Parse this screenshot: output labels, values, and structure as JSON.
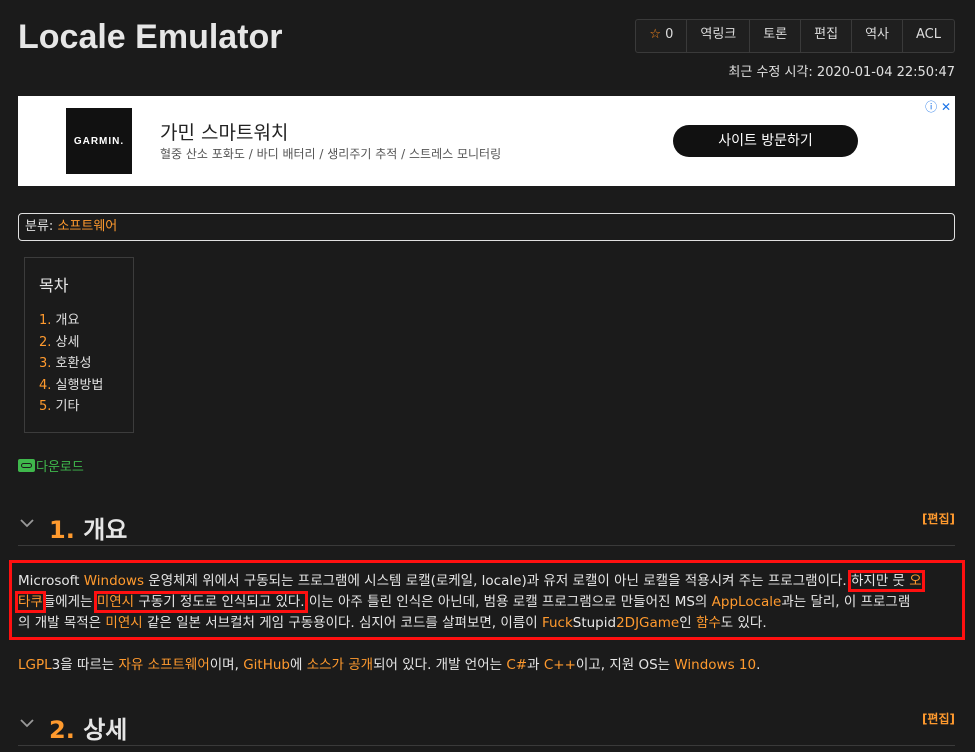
{
  "header": {
    "title": "Locale Emulator",
    "toolbar": [
      {
        "name": "star-button",
        "label": "0"
      },
      {
        "name": "backlinks-button",
        "label": "역링크"
      },
      {
        "name": "discussion-button",
        "label": "토론"
      },
      {
        "name": "edit-button",
        "label": "편집"
      },
      {
        "name": "history-button",
        "label": "역사"
      },
      {
        "name": "acl-button",
        "label": "ACL"
      }
    ],
    "star_icon": "☆",
    "last_modified": "최근 수정 시각: 2020-01-04 22:50:47"
  },
  "ad": {
    "logo": "GARMIN.",
    "title": "가민 스마트워치",
    "subtitle": "혈중 산소 포화도 / 바디 배터리 / 생리주기 추적 / 스트레스 모니터링",
    "button": "사이트 방문하기",
    "info_icon": "ⓘ ✕"
  },
  "category": {
    "label": "분류: ",
    "value": "소프트웨어"
  },
  "toc": {
    "title": "목차",
    "items": [
      {
        "num": "1.",
        "label": "개요"
      },
      {
        "num": "2.",
        "label": "상세"
      },
      {
        "num": "3.",
        "label": "호환성"
      },
      {
        "num": "4.",
        "label": "실행방법"
      },
      {
        "num": "5.",
        "label": "기타"
      }
    ]
  },
  "download": "다운로드",
  "sections": [
    {
      "num": "1.",
      "title": "개요",
      "edit": "[편집]"
    },
    {
      "num": "2.",
      "title": "상세",
      "edit": "[편집]"
    }
  ],
  "para1": {
    "l1a": "Microsoft ",
    "l1b": "Windows",
    "l1c": " 운영체제 위에서 구동되는 프로그램에 시스템 로캘(로케일, locale)과 유저 로캘이 아닌 로캘을 적용시켜 주는 프로그램이다. ",
    "l1d": "하지만 뭇 ",
    "l1e": "오",
    "l2a": "타쿠",
    "l2b": "들에게는 ",
    "l2c": "미연시",
    "l2d": " 구동기 정도로 인식되고 있다.",
    "l2e": " 이는 아주 틀린 인식은 아닌데, 범용 로캘 프로그램으로 만들어진 MS의 ",
    "l2f": "AppLocale",
    "l2g": "과는 달리, 이 프로그램",
    "l3a": "의 개발 목적은 ",
    "l3b": "미연시",
    "l3c": " 같은 일본 서브컬처 게임 구동용이다. 심지어 코드를 살펴보면, 이름이 ",
    "l3d": "Fuck",
    "l3e": "Stupid",
    "l3f": "2DJGame",
    "l3g": "인 ",
    "l3h": "함수",
    "l3i": "도 있다."
  },
  "para2": {
    "a": "LGPL",
    "b": "3을 따르는 ",
    "c": "자유 소프트웨어",
    "d": "이며, ",
    "e": "GitHub",
    "f": "에 ",
    "g": "소스가 공개",
    "h": "되어 있다. 개발 언어는 ",
    "i": "C#",
    "j": "과 ",
    "k": "C++",
    "l": "이고, 지원 OS는 ",
    "m": "Windows 10",
    "n": "."
  },
  "colors": {
    "background": "#1b1b1b",
    "link": "#ff9a2e",
    "download_link": "#3fb84c",
    "highlight_box": "#ff1010"
  }
}
